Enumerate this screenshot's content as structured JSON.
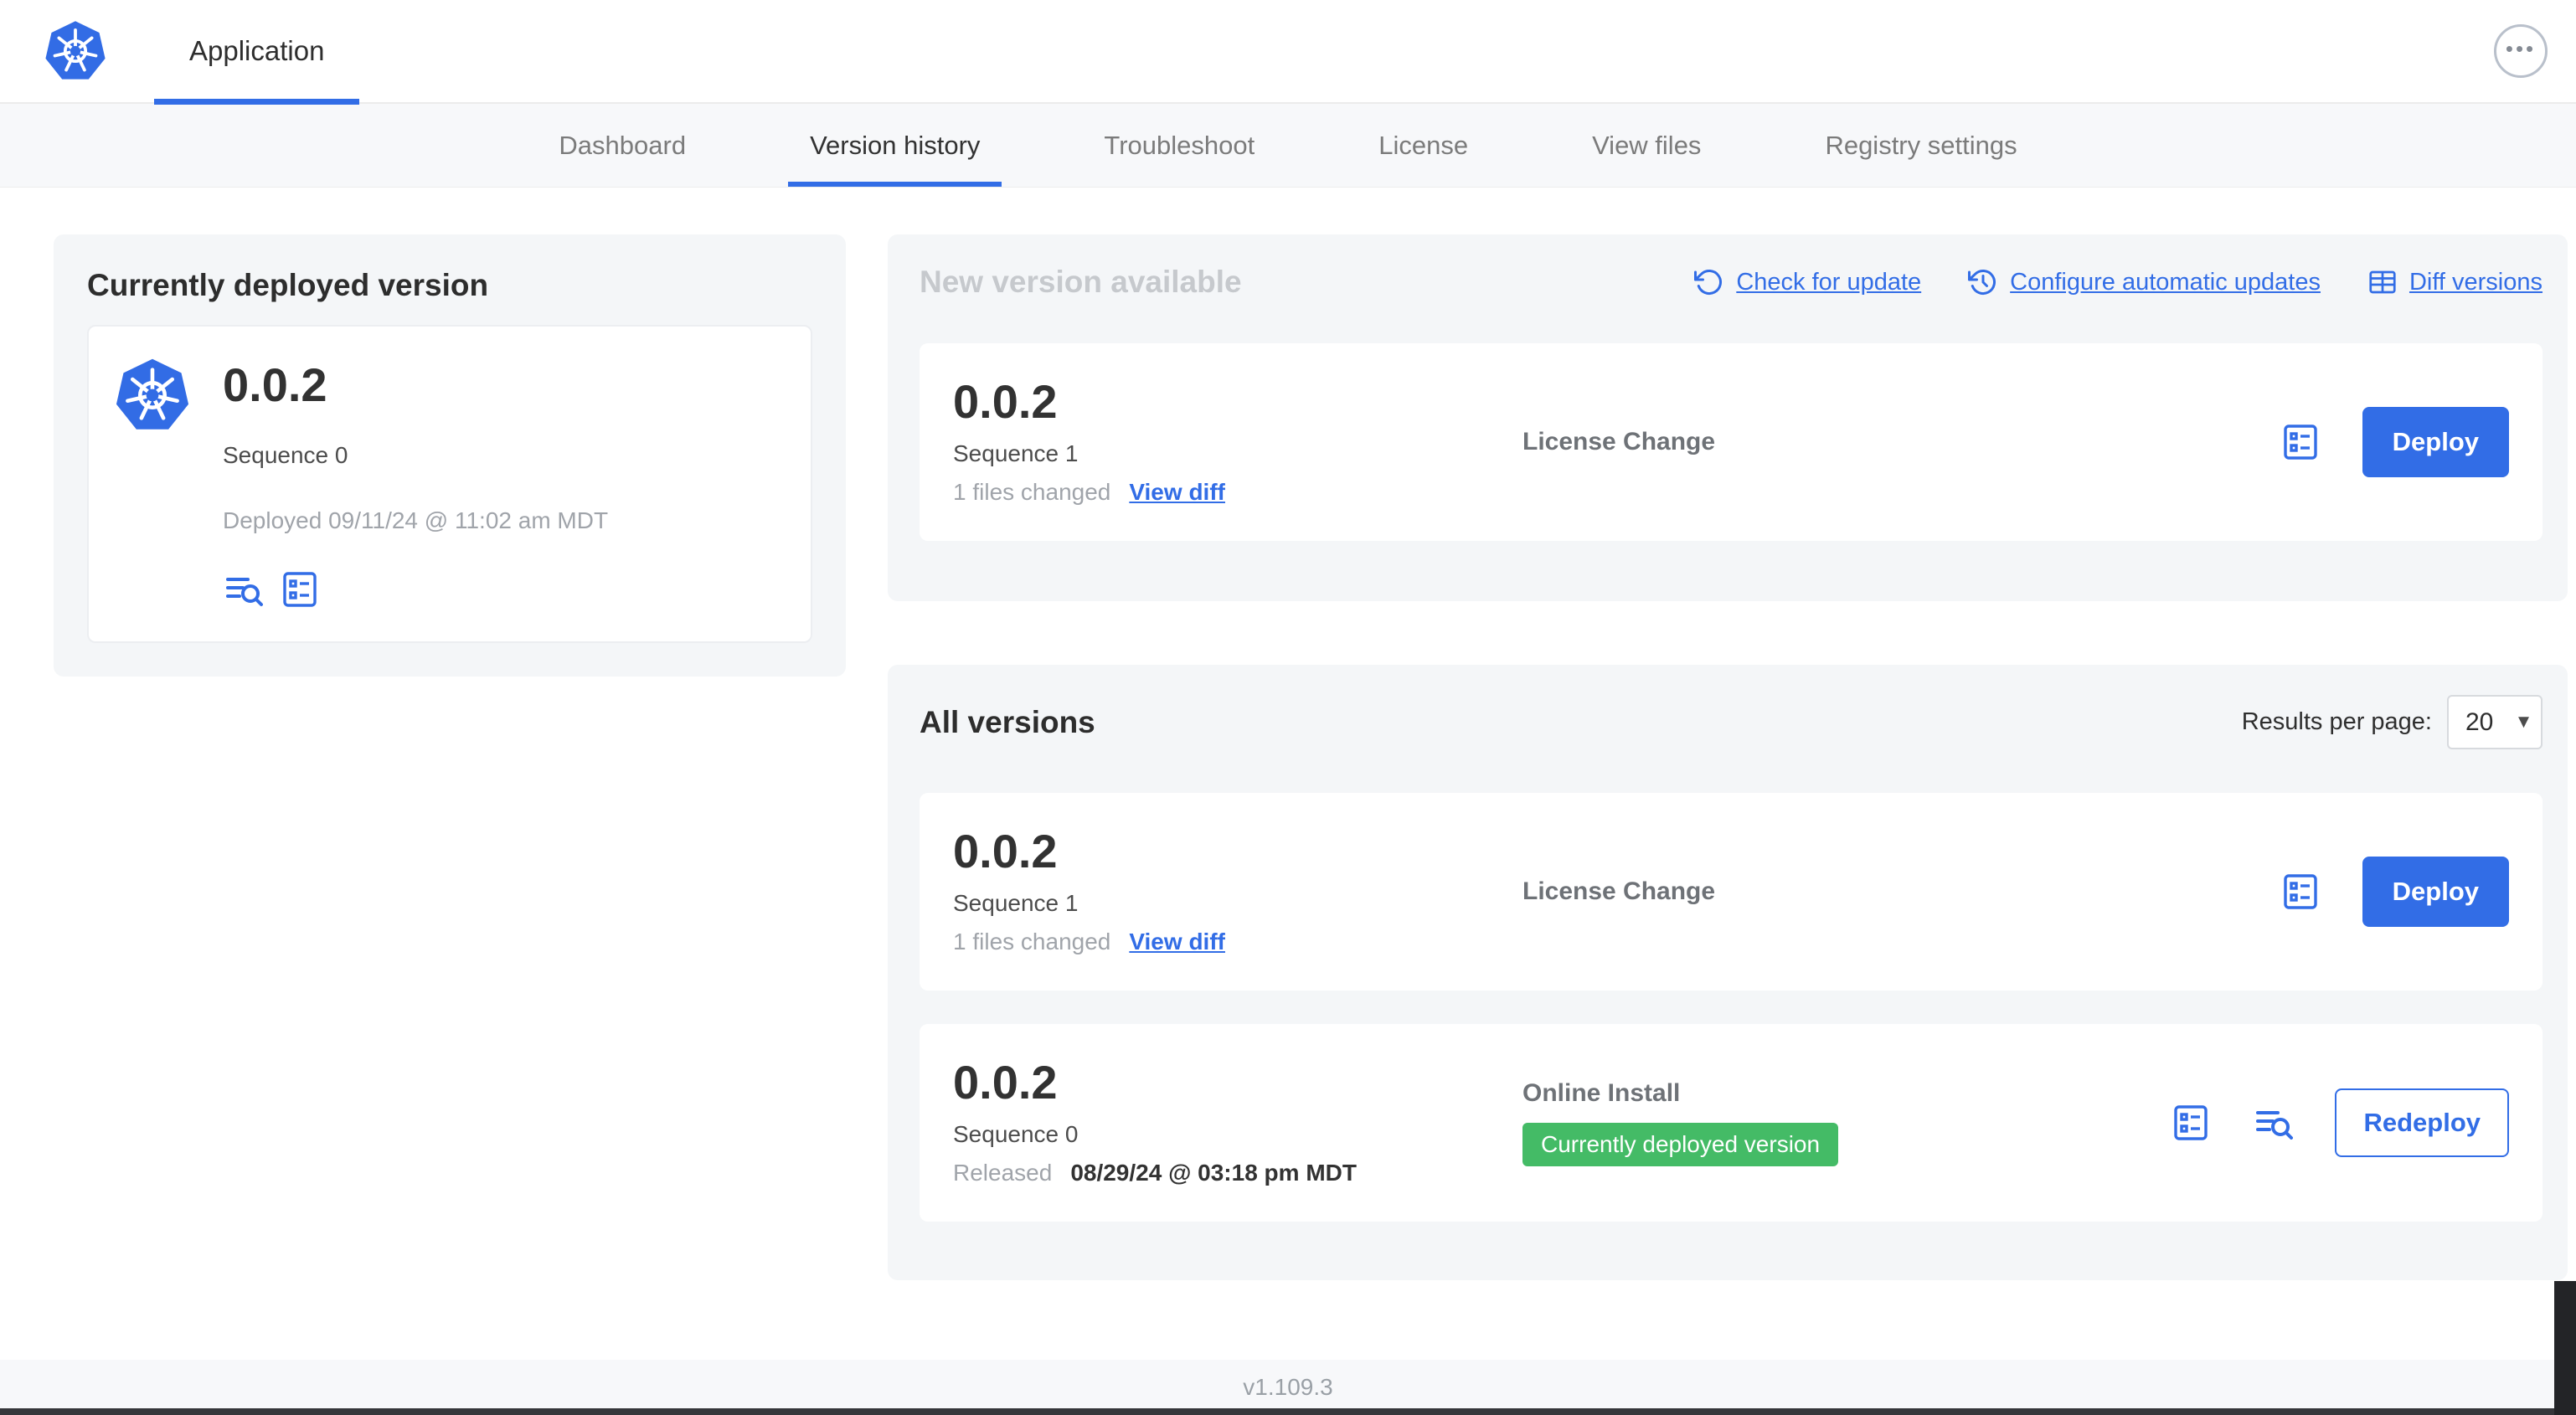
{
  "colors": {
    "accent": "#326DE6",
    "badge_green": "#44BB66",
    "muted_title": "#C6C9CD"
  },
  "icons": {
    "ellipsis": "•••",
    "select_chevron": "▾"
  },
  "header": {
    "app_tab": "Application"
  },
  "nav": {
    "tabs": {
      "dashboard": "Dashboard",
      "version_history": "Version history",
      "troubleshoot": "Troubleshoot",
      "license": "License",
      "view_files": "View files",
      "registry_settings": "Registry settings"
    }
  },
  "current_version": {
    "title": "Currently deployed version",
    "version": "0.0.2",
    "sequence": "Sequence 0",
    "deployed": "Deployed 09/11/24 @ 11:02 am MDT"
  },
  "new_version": {
    "title": "New version available",
    "check_for_update": "Check for update",
    "configure_updates": "Configure automatic updates",
    "diff_versions": "Diff versions",
    "card": {
      "version": "0.0.2",
      "sequence": "Sequence 1",
      "files_changed": "1 files changed",
      "view_diff": "View diff",
      "source": "License Change",
      "deploy": "Deploy"
    }
  },
  "all_versions": {
    "title": "All versions",
    "results_per_page_label": "Results per page:",
    "page_size": "20",
    "items": [
      {
        "version": "0.0.2",
        "sequence": "Sequence 1",
        "files_changed": "1 files changed",
        "view_diff": "View diff",
        "source": "License Change",
        "action": "Deploy"
      },
      {
        "version": "0.0.2",
        "sequence": "Sequence 0",
        "released_label": "Released",
        "released_date": "08/29/24 @ 03:18 pm MDT",
        "source": "Online Install",
        "badge": "Currently deployed version",
        "action": "Redeploy"
      }
    ]
  },
  "footer": {
    "app_version": "v1.109.3"
  }
}
